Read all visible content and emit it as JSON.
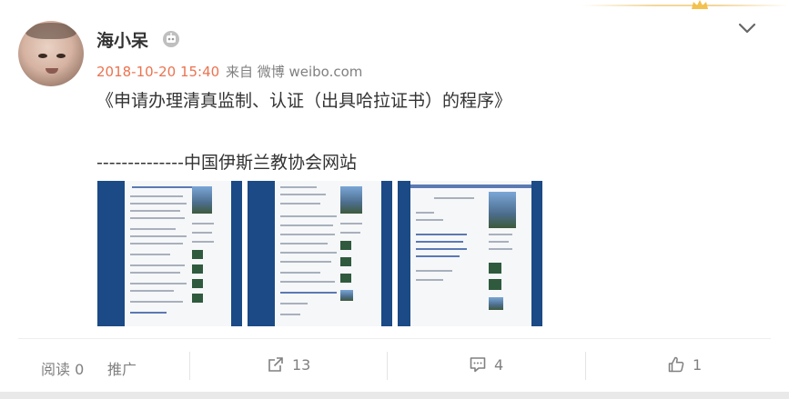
{
  "post": {
    "username": "海小呆",
    "timestamp": "2018-10-20 15:40",
    "source": "来自 微博 weibo.com",
    "text_line1": "《申请办理清真监制、认证（出具哈拉证书）的程序》",
    "text_line2": "--------------中国伊斯兰教协会网站"
  },
  "footer": {
    "read_label": "阅读 0",
    "promote_label": "推广",
    "share_count": "13",
    "comment_count": "4",
    "like_count": "1"
  },
  "icons": {
    "badge": "robot-badge-icon",
    "menu": "chevron-down-icon",
    "share": "share-icon",
    "comment": "comment-icon",
    "like": "thumbs-up-icon"
  },
  "colors": {
    "timestamp": "#eb7350",
    "thumb_frame": "#1b4a86",
    "muted": "#808080"
  }
}
